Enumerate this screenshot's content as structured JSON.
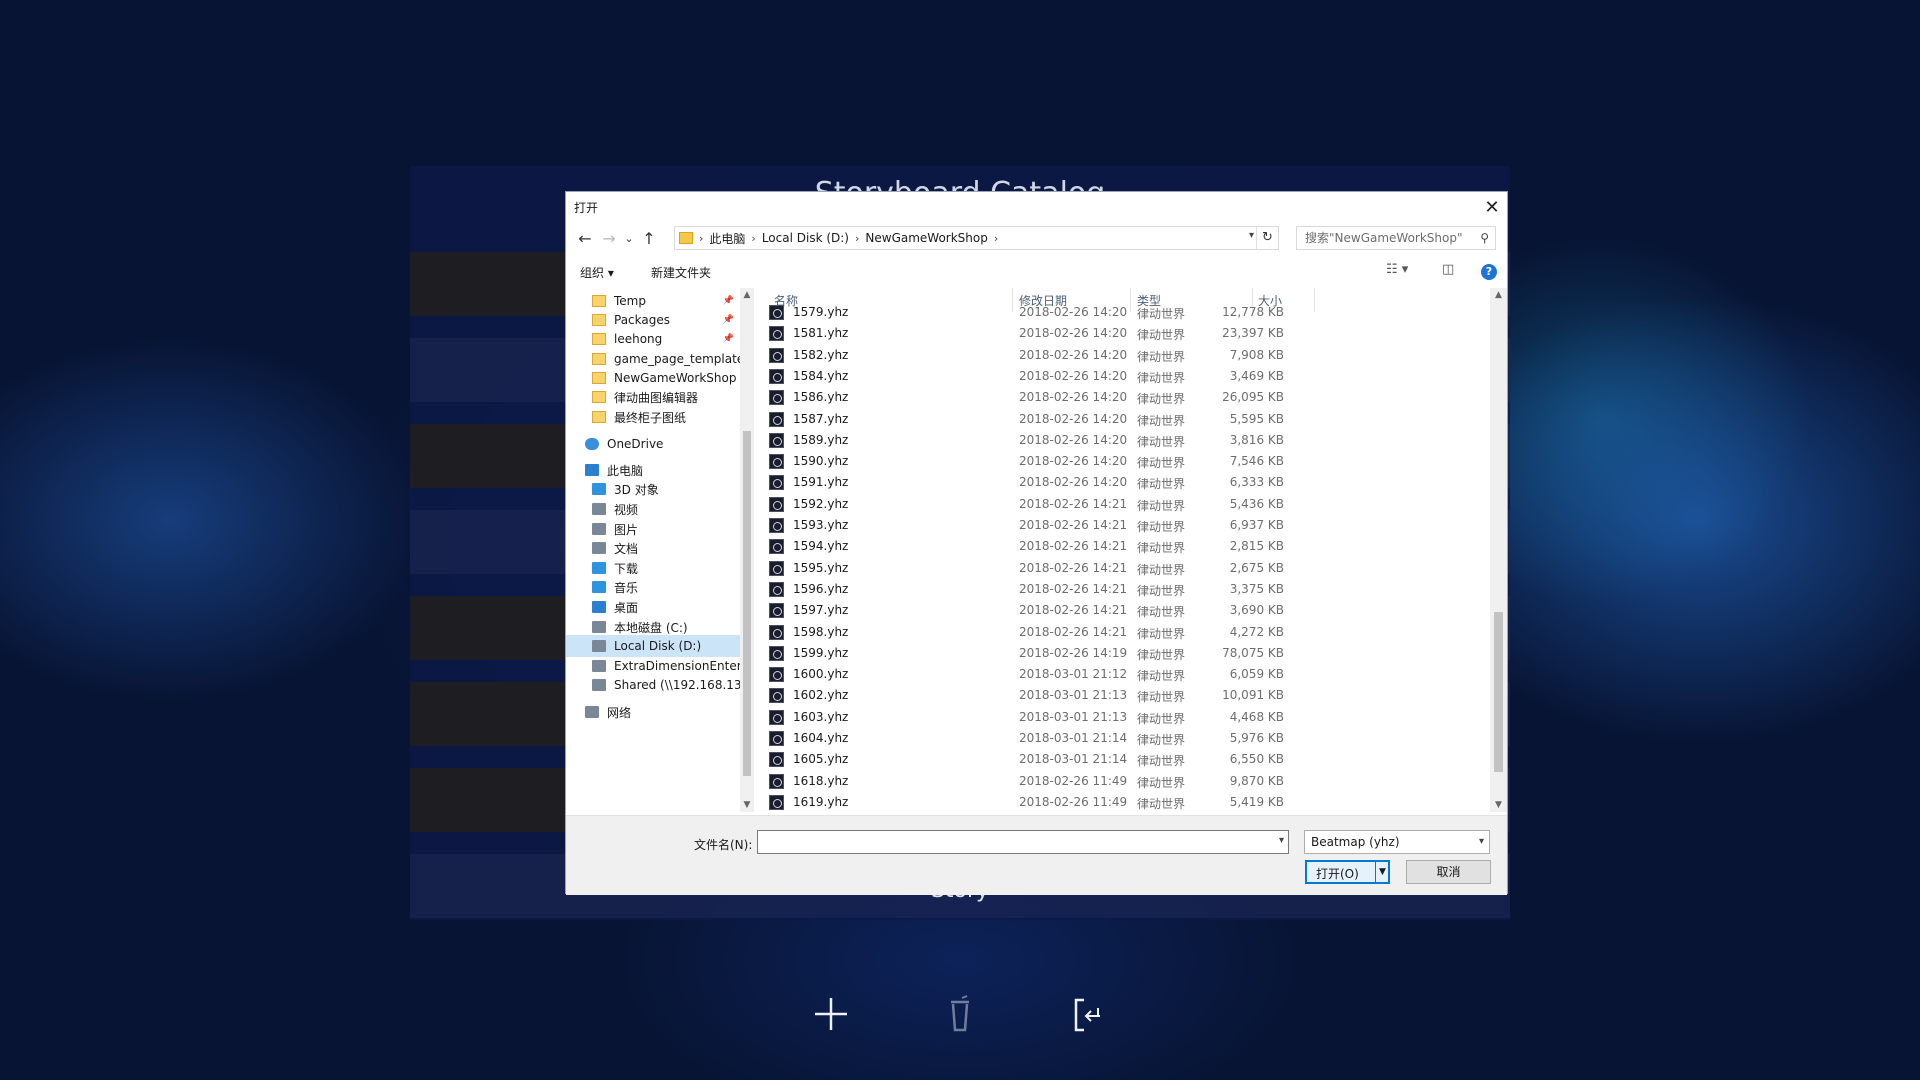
{
  "background_app": {
    "title": "Storyboard Catalog",
    "footer_text": "Story",
    "bottom_icons": [
      "plus-icon",
      "trash-icon",
      "exit-icon"
    ]
  },
  "dialog": {
    "title": "打开",
    "close_glyph": "✕",
    "nav": {
      "back": "←",
      "forward": "→",
      "recent": "⌄",
      "up": "↑"
    },
    "breadcrumb": [
      "此电脑",
      "Local Disk (D:)",
      "NewGameWorkShop"
    ],
    "search_placeholder": "搜索\"NewGameWorkShop\"",
    "toolbar": {
      "organize": "组织 ▾",
      "new_folder": "新建文件夹"
    },
    "sidebar": [
      {
        "label": "Temp",
        "icon": "folder-icon",
        "pinned": true
      },
      {
        "label": "Packages",
        "icon": "folder-icon",
        "pinned": true
      },
      {
        "label": "leehong",
        "icon": "folder-icon",
        "pinned": true
      },
      {
        "label": "game_page_template",
        "icon": "folder-icon",
        "pinned": false
      },
      {
        "label": "NewGameWorkShop",
        "icon": "folder-icon",
        "pinned": false
      },
      {
        "label": "律动曲图编辑器",
        "icon": "folder-icon",
        "pinned": false
      },
      {
        "label": "最终柜子图纸",
        "icon": "folder-icon",
        "pinned": false
      },
      {
        "label": "OneDrive",
        "icon": "cloud-icon",
        "pinned": false
      },
      {
        "label": "此电脑",
        "icon": "computer-icon",
        "pinned": false
      },
      {
        "label": "3D 对象",
        "icon": "cube-icon",
        "pinned": false
      },
      {
        "label": "视频",
        "icon": "video-icon",
        "pinned": false
      },
      {
        "label": "图片",
        "icon": "picture-icon",
        "pinned": false
      },
      {
        "label": "文档",
        "icon": "document-icon",
        "pinned": false
      },
      {
        "label": "下载",
        "icon": "download-icon",
        "pinned": false
      },
      {
        "label": "音乐",
        "icon": "music-icon",
        "pinned": false
      },
      {
        "label": "桌面",
        "icon": "desktop-icon",
        "pinned": false
      },
      {
        "label": "本地磁盘 (C:)",
        "icon": "drive-icon",
        "pinned": false
      },
      {
        "label": "Local Disk (D:)",
        "icon": "drive-icon",
        "pinned": false,
        "selected": true
      },
      {
        "label": "ExtraDimensionEnter",
        "icon": "drive-icon",
        "pinned": false
      },
      {
        "label": "Shared (\\\\192.168.13",
        "icon": "network-drive-icon",
        "pinned": false
      },
      {
        "label": "网络",
        "icon": "network-icon",
        "pinned": false
      }
    ],
    "columns": {
      "name": "名称",
      "date": "修改日期",
      "type": "类型",
      "size": "大小"
    },
    "files": [
      {
        "name": "1579.yhz",
        "date": "2018-02-26 14:20",
        "type": "律动世界",
        "size": "12,778 KB"
      },
      {
        "name": "1581.yhz",
        "date": "2018-02-26 14:20",
        "type": "律动世界",
        "size": "23,397 KB"
      },
      {
        "name": "1582.yhz",
        "date": "2018-02-26 14:20",
        "type": "律动世界",
        "size": "7,908 KB"
      },
      {
        "name": "1584.yhz",
        "date": "2018-02-26 14:20",
        "type": "律动世界",
        "size": "3,469 KB"
      },
      {
        "name": "1586.yhz",
        "date": "2018-02-26 14:20",
        "type": "律动世界",
        "size": "26,095 KB"
      },
      {
        "name": "1587.yhz",
        "date": "2018-02-26 14:20",
        "type": "律动世界",
        "size": "5,595 KB"
      },
      {
        "name": "1589.yhz",
        "date": "2018-02-26 14:20",
        "type": "律动世界",
        "size": "3,816 KB"
      },
      {
        "name": "1590.yhz",
        "date": "2018-02-26 14:20",
        "type": "律动世界",
        "size": "7,546 KB"
      },
      {
        "name": "1591.yhz",
        "date": "2018-02-26 14:20",
        "type": "律动世界",
        "size": "6,333 KB"
      },
      {
        "name": "1592.yhz",
        "date": "2018-02-26 14:21",
        "type": "律动世界",
        "size": "5,436 KB"
      },
      {
        "name": "1593.yhz",
        "date": "2018-02-26 14:21",
        "type": "律动世界",
        "size": "6,937 KB"
      },
      {
        "name": "1594.yhz",
        "date": "2018-02-26 14:21",
        "type": "律动世界",
        "size": "2,815 KB"
      },
      {
        "name": "1595.yhz",
        "date": "2018-02-26 14:21",
        "type": "律动世界",
        "size": "2,675 KB"
      },
      {
        "name": "1596.yhz",
        "date": "2018-02-26 14:21",
        "type": "律动世界",
        "size": "3,375 KB"
      },
      {
        "name": "1597.yhz",
        "date": "2018-02-26 14:21",
        "type": "律动世界",
        "size": "3,690 KB"
      },
      {
        "name": "1598.yhz",
        "date": "2018-02-26 14:21",
        "type": "律动世界",
        "size": "4,272 KB"
      },
      {
        "name": "1599.yhz",
        "date": "2018-02-26 14:19",
        "type": "律动世界",
        "size": "78,075 KB"
      },
      {
        "name": "1600.yhz",
        "date": "2018-03-01 21:12",
        "type": "律动世界",
        "size": "6,059 KB"
      },
      {
        "name": "1602.yhz",
        "date": "2018-03-01 21:13",
        "type": "律动世界",
        "size": "10,091 KB"
      },
      {
        "name": "1603.yhz",
        "date": "2018-03-01 21:13",
        "type": "律动世界",
        "size": "4,468 KB"
      },
      {
        "name": "1604.yhz",
        "date": "2018-03-01 21:14",
        "type": "律动世界",
        "size": "5,976 KB"
      },
      {
        "name": "1605.yhz",
        "date": "2018-03-01 21:14",
        "type": "律动世界",
        "size": "6,550 KB"
      },
      {
        "name": "1618.yhz",
        "date": "2018-02-26 11:49",
        "type": "律动世界",
        "size": "9,870 KB"
      },
      {
        "name": "1619.yhz",
        "date": "2018-02-26 11:49",
        "type": "律动世界",
        "size": "5,419 KB"
      }
    ],
    "filename_label": "文件名(N):",
    "filename_value": "",
    "filetype_value": "Beatmap (yhz)",
    "open_label": "打开(O)",
    "cancel_label": "取消"
  }
}
